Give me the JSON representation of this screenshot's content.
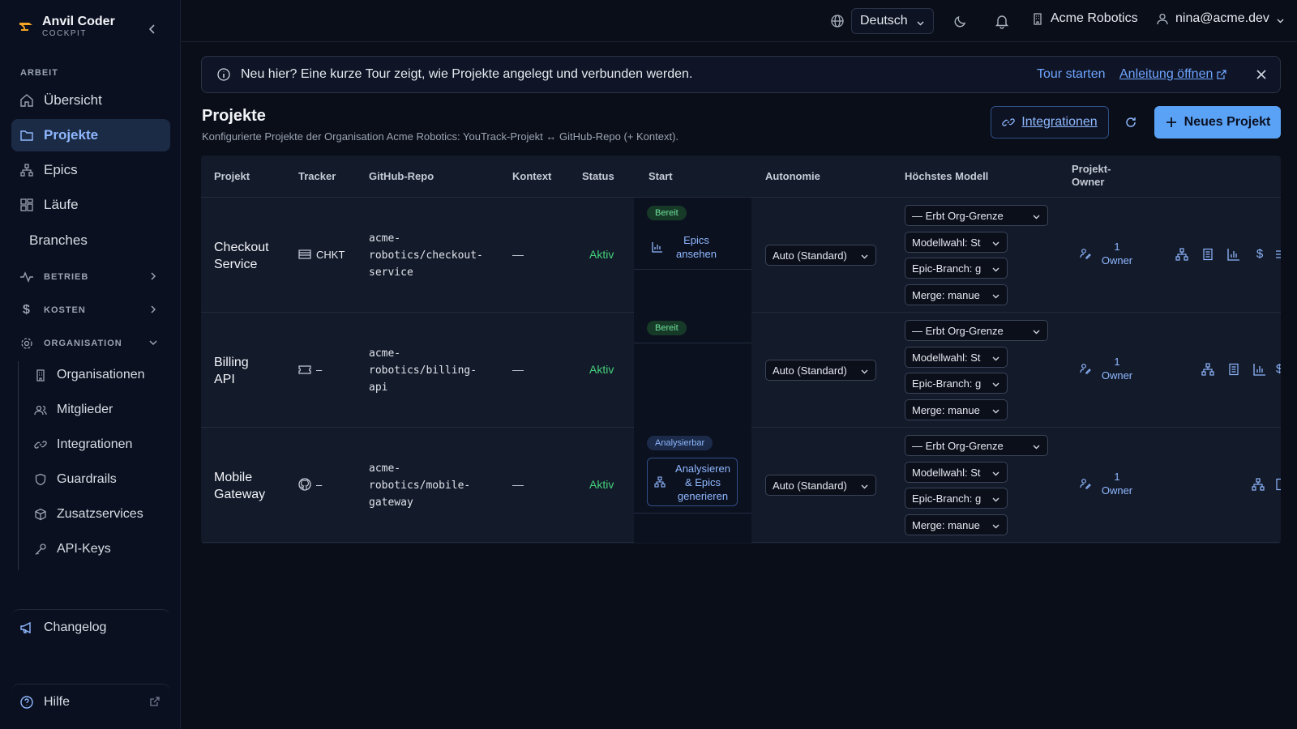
{
  "app": {
    "title": "Anvil Coder",
    "subtitle": "COCKPIT"
  },
  "sidebar": {
    "section_work": "ARBEIT",
    "items": [
      {
        "label": "Übersicht",
        "icon": "home-icon"
      },
      {
        "label": "Projekte",
        "icon": "folder-icon"
      },
      {
        "label": "Epics",
        "icon": "hierarchy-icon"
      },
      {
        "label": "Läufe",
        "icon": "grid-icon"
      },
      {
        "label": "Branches",
        "icon": ""
      }
    ],
    "groups": [
      {
        "label": "BETRIEB",
        "icon": "activity-icon"
      },
      {
        "label": "KOSTEN",
        "icon": "dollar-icon"
      },
      {
        "label": "ORGANISATION",
        "icon": "gear-icon"
      }
    ],
    "org_items": [
      {
        "label": "Organisationen",
        "icon": "building-icon"
      },
      {
        "label": "Mitglieder",
        "icon": "users-icon"
      },
      {
        "label": "Integrationen",
        "icon": "link-icon"
      },
      {
        "label": "Guardrails",
        "icon": "shield-icon"
      },
      {
        "label": "Zusatzservices",
        "icon": "box-icon"
      },
      {
        "label": "API-Keys",
        "icon": "key-icon"
      }
    ],
    "changelog": "Changelog",
    "help": "Hilfe"
  },
  "topbar": {
    "language": "Deutsch",
    "organization": "Acme Robotics",
    "user": "nina@acme.dev"
  },
  "banner": {
    "text": "Neu hier? Eine kurze Tour zeigt, wie Projekte angelegt und verbunden werden.",
    "tour": "Tour starten",
    "guide": "Anleitung öffnen"
  },
  "page": {
    "title": "Projekte",
    "subtitle": "Konfigurierte Projekte der Organisation Acme Robotics: YouTrack-Projekt ↔ GitHub-Repo (+ Kontext).",
    "integrations_button": "Integrationen",
    "new_project_button": "Neues Projekt"
  },
  "table": {
    "headers": {
      "project": "Projekt",
      "tracker": "Tracker",
      "repo": "GitHub-Repo",
      "context": "Kontext",
      "status": "Status",
      "start": "Start",
      "autonomy": "Autonomie",
      "model": "Höchstes Modell",
      "owner_1": "Projekt-",
      "owner_2": "Owner"
    },
    "rows": [
      {
        "name_1": "Checkout",
        "name_2": "Service",
        "tracker": "CHKT",
        "tracker_icon": "youtrack-icon",
        "repo_1": "acme-",
        "repo_2": "robotics/checkout-",
        "repo_3": "service",
        "context": "—",
        "status": "Aktiv",
        "badge": "Bereit",
        "badge_color": "green",
        "start_action_1": "Epics",
        "start_action_2": "ansehen",
        "autonomy": "Auto (Standard)",
        "model": "— Erbt Org-Grenze",
        "model_choice": "Modellwahl: St",
        "epic_branch": "Epic-Branch: g",
        "merge": "Merge: manue",
        "owner_count": "1",
        "owner_label": "Owner"
      },
      {
        "name_1": "Billing",
        "name_2": "API",
        "tracker": "–",
        "tracker_icon": "ticket-icon",
        "repo_1": "acme-",
        "repo_2": "robotics/billing-",
        "repo_3": "api",
        "context": "—",
        "status": "Aktiv",
        "badge": "Bereit",
        "badge_color": "green",
        "autonomy": "Auto (Standard)",
        "model": "— Erbt Org-Grenze",
        "model_choice": "Modellwahl: St",
        "epic_branch": "Epic-Branch: g",
        "merge": "Merge: manue",
        "owner_count": "1",
        "owner_label": "Owner"
      },
      {
        "name_1": "Mobile",
        "name_2": "Gateway",
        "tracker": "–",
        "tracker_icon": "github-icon",
        "repo_1": "acme-",
        "repo_2": "robotics/mobile-",
        "repo_3": "gateway",
        "context": "—",
        "status": "Aktiv",
        "badge": "Analysierbar",
        "badge_color": "blue",
        "start_action_1": "Analysieren",
        "start_action_2": "& Epics",
        "start_action_3": "generieren",
        "autonomy": "Auto (Standard)",
        "model": "— Erbt Org-Grenze",
        "model_choice": "Modellwahl: St",
        "epic_branch": "Epic-Branch: g",
        "merge": "Merge: manue",
        "owner_count": "1",
        "owner_label": "Owner"
      }
    ]
  },
  "colors": {
    "accent": "#5aa2f5",
    "active": "#44d17a",
    "background": "#0a0e18"
  }
}
